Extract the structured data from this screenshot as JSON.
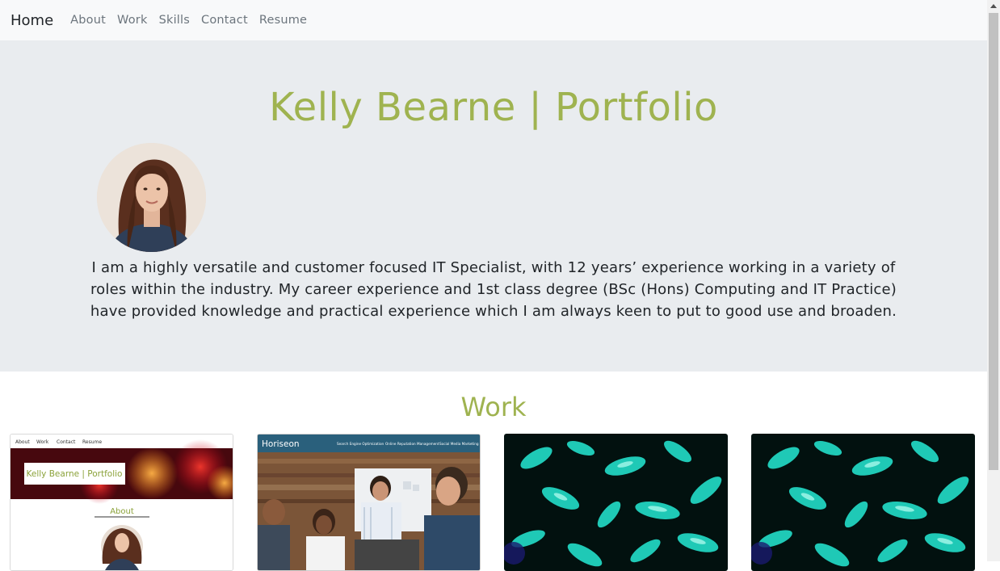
{
  "nav": {
    "brand": "Home",
    "items": [
      "About",
      "Work",
      "Skills",
      "Contact",
      "Resume"
    ]
  },
  "hero": {
    "title": "Kelly Bearne | Portfolio",
    "bio": "I am a highly versatile and customer focused IT Specialist, with 12 years’ experience working in a variety of roles within the industry. My career experience and 1st class degree (BSc (Hons) Computing and IT Practice) have provided knowledge and practical experience which I am always keen to put to good use and broaden."
  },
  "work": {
    "title": "Work",
    "card1": {
      "nav": [
        "About",
        "Work",
        "Contact",
        "Resume"
      ],
      "banner": "Kelly Bearne | Portfolio",
      "section": "About"
    },
    "card2": {
      "brand": "Horiseon",
      "nav": [
        "Search Engine Optimization",
        "Online Reputation Management",
        "Social Media Marketing"
      ]
    }
  },
  "colors": {
    "accent": "#9fb350",
    "hero_bg": "#e9ecef",
    "navbar_bg": "#f8f9fa",
    "horiseon_header": "#2a607c",
    "teal": "#1fc9b6"
  }
}
